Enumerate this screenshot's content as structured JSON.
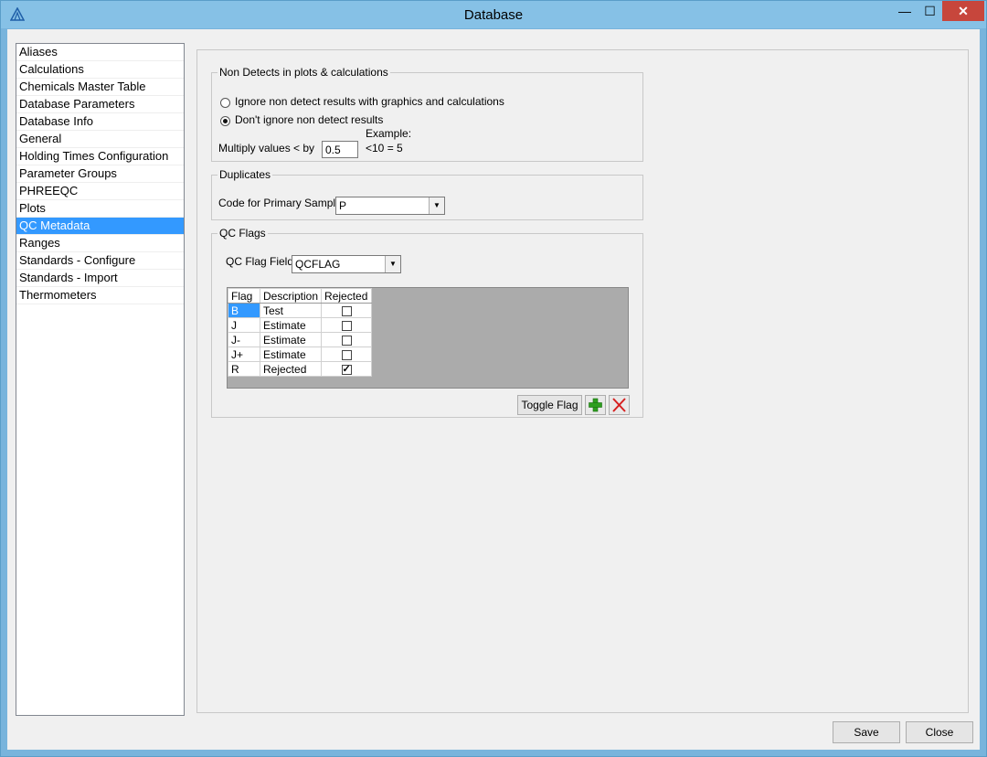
{
  "window": {
    "title": "Database",
    "controls": {
      "minimize": "—",
      "maximize": "☐",
      "close": "✕"
    }
  },
  "sidebar": {
    "items": [
      {
        "label": "Aliases"
      },
      {
        "label": "Calculations"
      },
      {
        "label": "Chemicals Master Table"
      },
      {
        "label": "Database Parameters"
      },
      {
        "label": "Database Info"
      },
      {
        "label": "General"
      },
      {
        "label": "Holding Times Configuration"
      },
      {
        "label": "Parameter Groups"
      },
      {
        "label": "PHREEQC"
      },
      {
        "label": "Plots"
      },
      {
        "label": "QC Metadata"
      },
      {
        "label": "Ranges"
      },
      {
        "label": "Standards - Configure"
      },
      {
        "label": "Standards - Import"
      },
      {
        "label": "Thermometers"
      }
    ],
    "selected": "QC Metadata"
  },
  "non_detects": {
    "legend": "Non Detects in plots & calculations",
    "option_ignore": "Ignore non detect results with graphics and calculations",
    "option_dont_ignore": "Don't ignore non detect results",
    "selected_option": "Don't ignore non detect results",
    "multiply_label": "Multiply values < by",
    "multiply_value": "0.5",
    "example_label": "Example:",
    "example_value": "<10 = 5"
  },
  "duplicates": {
    "legend": "Duplicates",
    "primary_label": "Code for Primary Sample",
    "primary_value": "P"
  },
  "qc_flags": {
    "legend": "QC Flags",
    "field_label": "QC Flag Field",
    "field_value": "QCFLAG",
    "columns": [
      "Flag",
      "Description",
      "Rejected"
    ],
    "rows": [
      {
        "flag": "B",
        "description": "Test",
        "rejected": false
      },
      {
        "flag": "J",
        "description": "Estimate",
        "rejected": false
      },
      {
        "flag": "J-",
        "description": "Estimate",
        "rejected": false
      },
      {
        "flag": "J+",
        "description": "Estimate",
        "rejected": false
      },
      {
        "flag": "R",
        "description": "Rejected",
        "rejected": true
      }
    ],
    "toggle_label": "Toggle Flag",
    "add_icon": "plus-icon",
    "delete_icon": "x-icon"
  },
  "footer": {
    "save_label": "Save",
    "close_label": "Close"
  },
  "colors": {
    "title_bar": "#86c1e6",
    "selection": "#3399ff",
    "close_button": "#c7463c",
    "add_icon": "#2e9e1f",
    "delete_icon": "#d62020"
  }
}
